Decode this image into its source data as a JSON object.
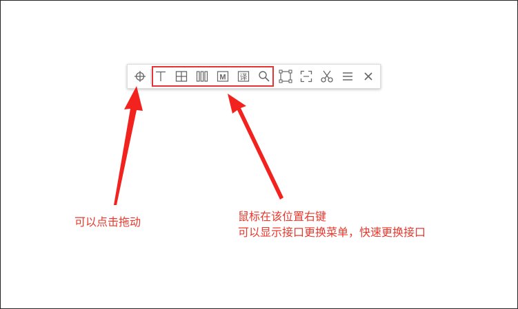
{
  "toolbar": {
    "buttons": [
      {
        "id": "drag",
        "icon": "crosshair-icon"
      },
      {
        "id": "text",
        "icon": "text-t-icon"
      },
      {
        "id": "table",
        "icon": "table-grid-icon"
      },
      {
        "id": "columns",
        "icon": "columns-icon"
      },
      {
        "id": "math",
        "icon": "formula-m-icon",
        "text": "M"
      },
      {
        "id": "translate",
        "icon": "translate-icon",
        "text": "译"
      },
      {
        "id": "search",
        "icon": "search-icon"
      },
      {
        "id": "select-area",
        "icon": "select-area-icon"
      },
      {
        "id": "screenshot",
        "icon": "screenshot-frame-icon"
      },
      {
        "id": "cut",
        "icon": "scissors-icon"
      },
      {
        "id": "menu",
        "icon": "hamburger-menu-icon"
      },
      {
        "id": "close",
        "icon": "close-icon"
      }
    ]
  },
  "annotations": {
    "drag_note": "可以点击拖动",
    "interface_note_line1": "鼠标在该位置右键",
    "interface_note_line2": "可以显示接口更换菜单，快速更换接口"
  },
  "colors": {
    "accent_red": "#e53333",
    "icon_gray": "#666666",
    "annotation_text": "#e8382d"
  }
}
